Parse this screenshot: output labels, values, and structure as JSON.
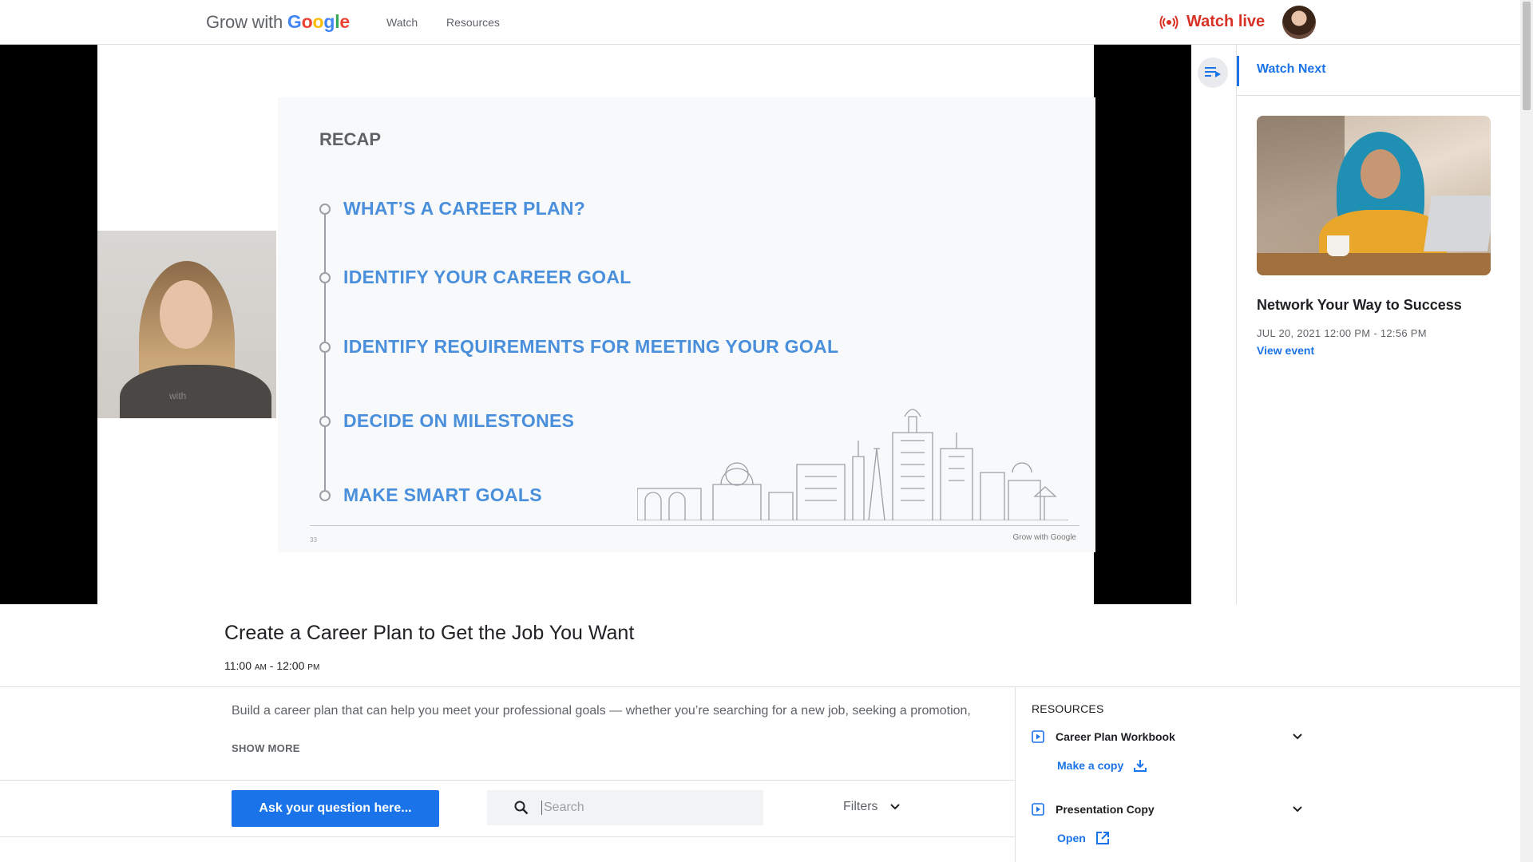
{
  "header": {
    "logo_prefix": "Grow with ",
    "logo_brand": "Google",
    "nav": [
      "Watch",
      "Resources"
    ],
    "watch_live": "Watch live"
  },
  "slide": {
    "heading": "RECAP",
    "steps": [
      "WHAT’S A CAREER PLAN?",
      "IDENTIFY YOUR CAREER GOAL",
      "IDENTIFY REQUIREMENTS FOR MEETING YOUR GOAL",
      "DECIDE ON MILESTONES",
      "MAKE SMART GOALS"
    ],
    "page_number": "33",
    "brand": "Grow with Google",
    "webcam_shirt_text": "with"
  },
  "sidebar": {
    "tab_label": "Watch Next",
    "next_title": "Network Your Way to Success",
    "next_date": "JUL 20, 2021 12:00 PM  - 12:56 PM",
    "view_event": "View event"
  },
  "event": {
    "title": "Create a Career Plan to Get the Job You Want",
    "time_start": "11:00",
    "time_start_period": "AM",
    "time_sep": " - ",
    "time_end": "12:00",
    "time_end_period": "PM",
    "description": "Build a career plan that can help you meet your professional goals — whether you’re searching for a new job, seeking a promotion,",
    "show_more": "SHOW MORE"
  },
  "qa": {
    "ask_button": "Ask your question here...",
    "search_placeholder": "Search",
    "filters_label": "Filters"
  },
  "resources": {
    "heading": "RESOURCES",
    "items": [
      {
        "label": "Career Plan Workbook",
        "action": "Make a copy"
      },
      {
        "label": "Presentation Copy",
        "action": "Open"
      }
    ]
  },
  "colors": {
    "accent": "#1a73e8",
    "live": "#d93025",
    "slide_step": "#4a8fdc"
  }
}
